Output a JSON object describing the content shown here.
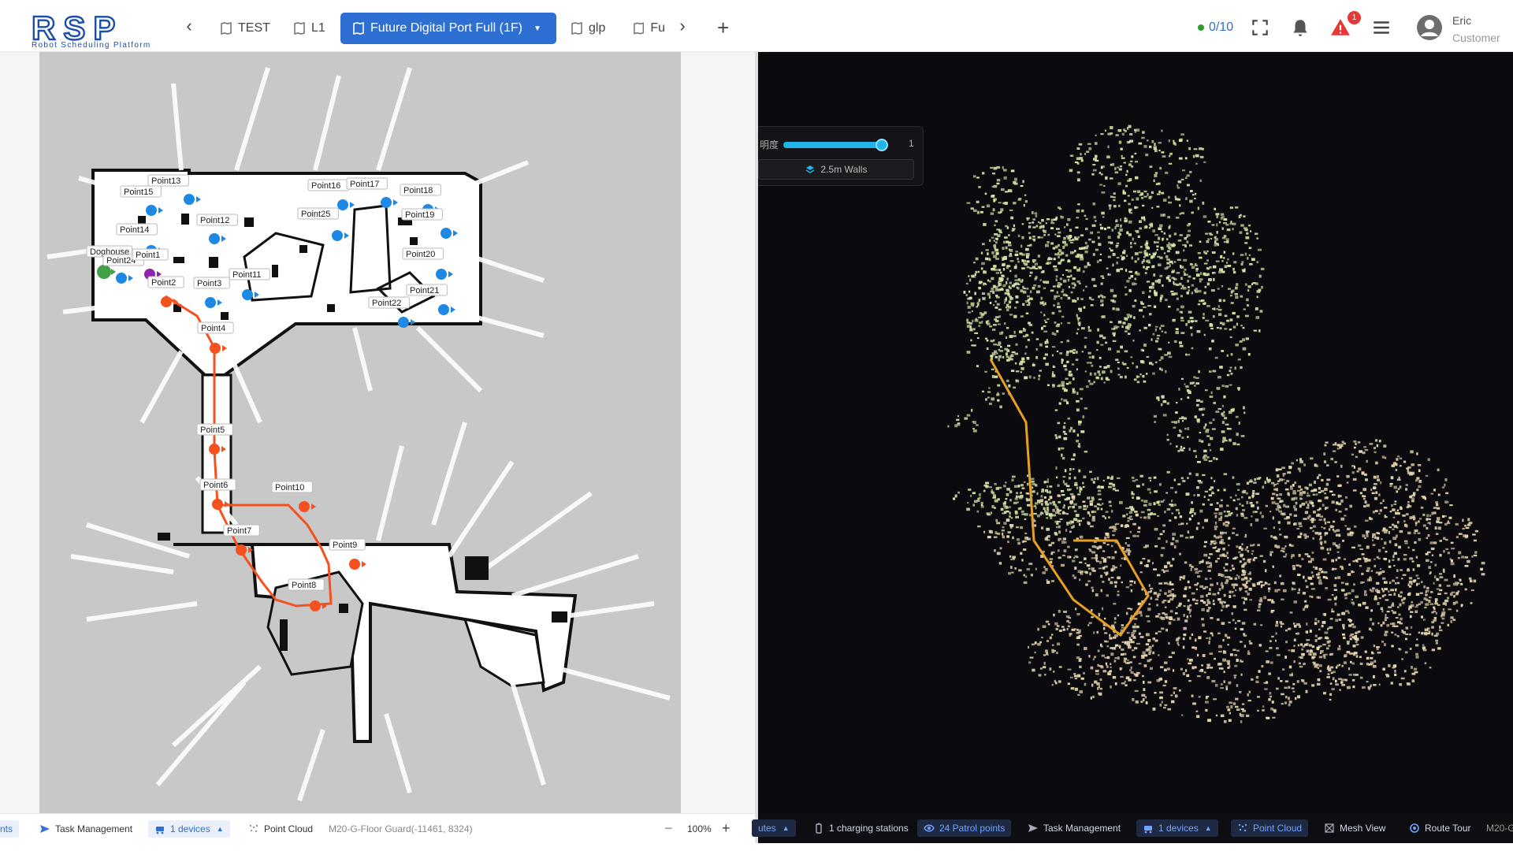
{
  "header": {
    "logo_text": "RSP",
    "logo_subtitle": "Robot Scheduling Platform",
    "tabs": [
      {
        "label": "TEST"
      },
      {
        "label": "L1"
      },
      {
        "label": "Future Digital Port Full (1F)",
        "active": true
      },
      {
        "label": "glp"
      },
      {
        "label": "Fu"
      }
    ],
    "robot_count": "0/10",
    "alert_badge": "1",
    "user_name": "Eric",
    "user_role": "Customer",
    "icons": [
      "chevron-left-icon",
      "chevron-right-icon",
      "plus-icon",
      "fullscreen-icon",
      "bell-icon",
      "warning-icon",
      "menu-icon",
      "user-avatar-icon"
    ]
  },
  "left_map": {
    "points": [
      {
        "name": "Point13",
        "type": "patrol"
      },
      {
        "name": "Point15",
        "type": "patrol"
      },
      {
        "name": "Point16",
        "type": "patrol"
      },
      {
        "name": "Point17",
        "type": "patrol"
      },
      {
        "name": "Point18",
        "type": "patrol"
      },
      {
        "name": "Point19",
        "type": "patrol"
      },
      {
        "name": "Point25",
        "type": "patrol"
      },
      {
        "name": "Point12",
        "type": "patrol"
      },
      {
        "name": "Point14",
        "type": "patrol"
      },
      {
        "name": "Doghouse",
        "type": "charger"
      },
      {
        "name": "Point24",
        "type": "patrol"
      },
      {
        "name": "Point1",
        "type": "start"
      },
      {
        "name": "Point20",
        "type": "patrol"
      },
      {
        "name": "Point11",
        "type": "patrol"
      },
      {
        "name": "Point2",
        "type": "route"
      },
      {
        "name": "Point3",
        "type": "patrol"
      },
      {
        "name": "Point21",
        "type": "patrol"
      },
      {
        "name": "Point22",
        "type": "patrol"
      },
      {
        "name": "Point4",
        "type": "route"
      },
      {
        "name": "Point5",
        "type": "route"
      },
      {
        "name": "Point6",
        "type": "route"
      },
      {
        "name": "Point10",
        "type": "route"
      },
      {
        "name": "Point7",
        "type": "route"
      },
      {
        "name": "Point9",
        "type": "route"
      },
      {
        "name": "Point8",
        "type": "route"
      }
    ],
    "colors": {
      "patrol": "#1e88e5",
      "route": "#f4511e",
      "start": "#8e24aa",
      "charger": "#43a047"
    }
  },
  "right_panel": {
    "brightness_label": "明度",
    "brightness_value": "1",
    "brightness_level": 0.85,
    "walls_button": "2.5m Walls",
    "route_color": "#e8a020",
    "cloud_colors": [
      "#d8e6a8",
      "#e8d9b0"
    ]
  },
  "left_bottombar": {
    "partial_item": "nts",
    "task_management": "Task Management",
    "devices": "1 devices",
    "point_cloud": "Point Cloud",
    "robot_info": "M20-G-Floor Guard(-11461, 8324)",
    "zoom": "100%"
  },
  "right_bottombar": {
    "partial_item": "utes",
    "charging": "1 charging stations",
    "patrol": "24 Patrol points",
    "task_management": "Task Management",
    "devices": "1 devices",
    "point_cloud": "Point Cloud",
    "mesh_view": "Mesh View",
    "route_tour": "Route Tour",
    "trailing": "M20-G"
  }
}
